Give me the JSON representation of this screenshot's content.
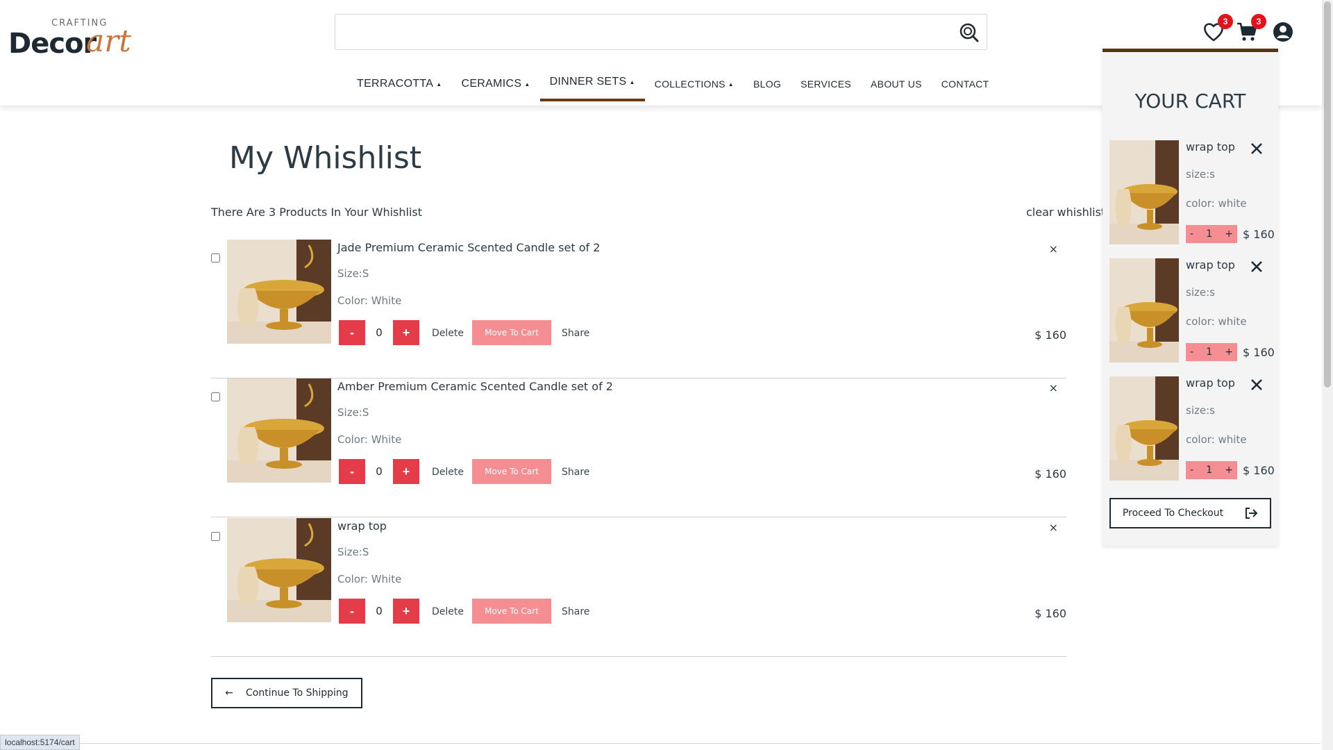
{
  "brand": {
    "top": "CRAFTING",
    "main": "Decor",
    "accent": "art"
  },
  "search": {
    "placeholder": ""
  },
  "nav": [
    {
      "label": "TERRACOTTA",
      "caret": "▲"
    },
    {
      "label": "CERAMICS",
      "caret": "▲"
    },
    {
      "label": "DINNER SETS",
      "caret": "▲"
    },
    {
      "label": "COLLECTIONS",
      "caret": "▲"
    },
    {
      "label": "BLOG"
    },
    {
      "label": "SERVICES"
    },
    {
      "label": "ABOUT US"
    },
    {
      "label": "CONTACT"
    }
  ],
  "header_icons": {
    "wishlist_count": "3",
    "cart_count": "3"
  },
  "wishlist": {
    "title": "My Whishlist",
    "count_text": "There Are 3 Products In Your Whishlist",
    "clear_label": "clear whishlist",
    "items": [
      {
        "name": "Jade Premium Ceramic Scented Candle set of 2",
        "size": "Size:S",
        "color": "Color: White",
        "qty": "0",
        "minus": "-",
        "plus": "+",
        "delete": "Delete",
        "move": "Move To Cart",
        "share": "Share",
        "remove": "×",
        "price": "$ 160"
      },
      {
        "name": "Amber Premium Ceramic Scented Candle set of 2",
        "size": "Size:S",
        "color": "Color: White",
        "qty": "0",
        "minus": "-",
        "plus": "+",
        "delete": "Delete",
        "move": "Move To Cart",
        "share": "Share",
        "remove": "×",
        "price": "$ 160"
      },
      {
        "name": "wrap top",
        "size": "Size:S",
        "color": "Color: White",
        "qty": "0",
        "minus": "-",
        "plus": "+",
        "delete": "Delete",
        "move": "Move To Cart",
        "share": "Share",
        "remove": "×",
        "price": "$ 160"
      }
    ],
    "continue_label": "Continue To Shipping",
    "continue_arrow": "←"
  },
  "cart": {
    "title": "YOUR CART",
    "items": [
      {
        "name": "wrap top",
        "size": "size:s",
        "color": "color: white",
        "qty": "1",
        "minus": "-",
        "plus": "+",
        "price": "$ 160"
      },
      {
        "name": "wrap top",
        "size": "size:s",
        "color": "color: white",
        "qty": "1",
        "minus": "-",
        "plus": "+",
        "price": "$ 160"
      },
      {
        "name": "wrap top",
        "size": "size:s",
        "color": "color: white",
        "qty": "1",
        "minus": "-",
        "plus": "+",
        "price": "$ 160"
      }
    ],
    "checkout_label": "Proceed To Checkout"
  },
  "status_url": "localhost:5174/cart",
  "colors": {
    "accent": "#e43c48",
    "move_btn": "#f58e92",
    "brand_brown": "#5a3510",
    "badge": "#e3131b",
    "logo_art": "#c8773f"
  }
}
